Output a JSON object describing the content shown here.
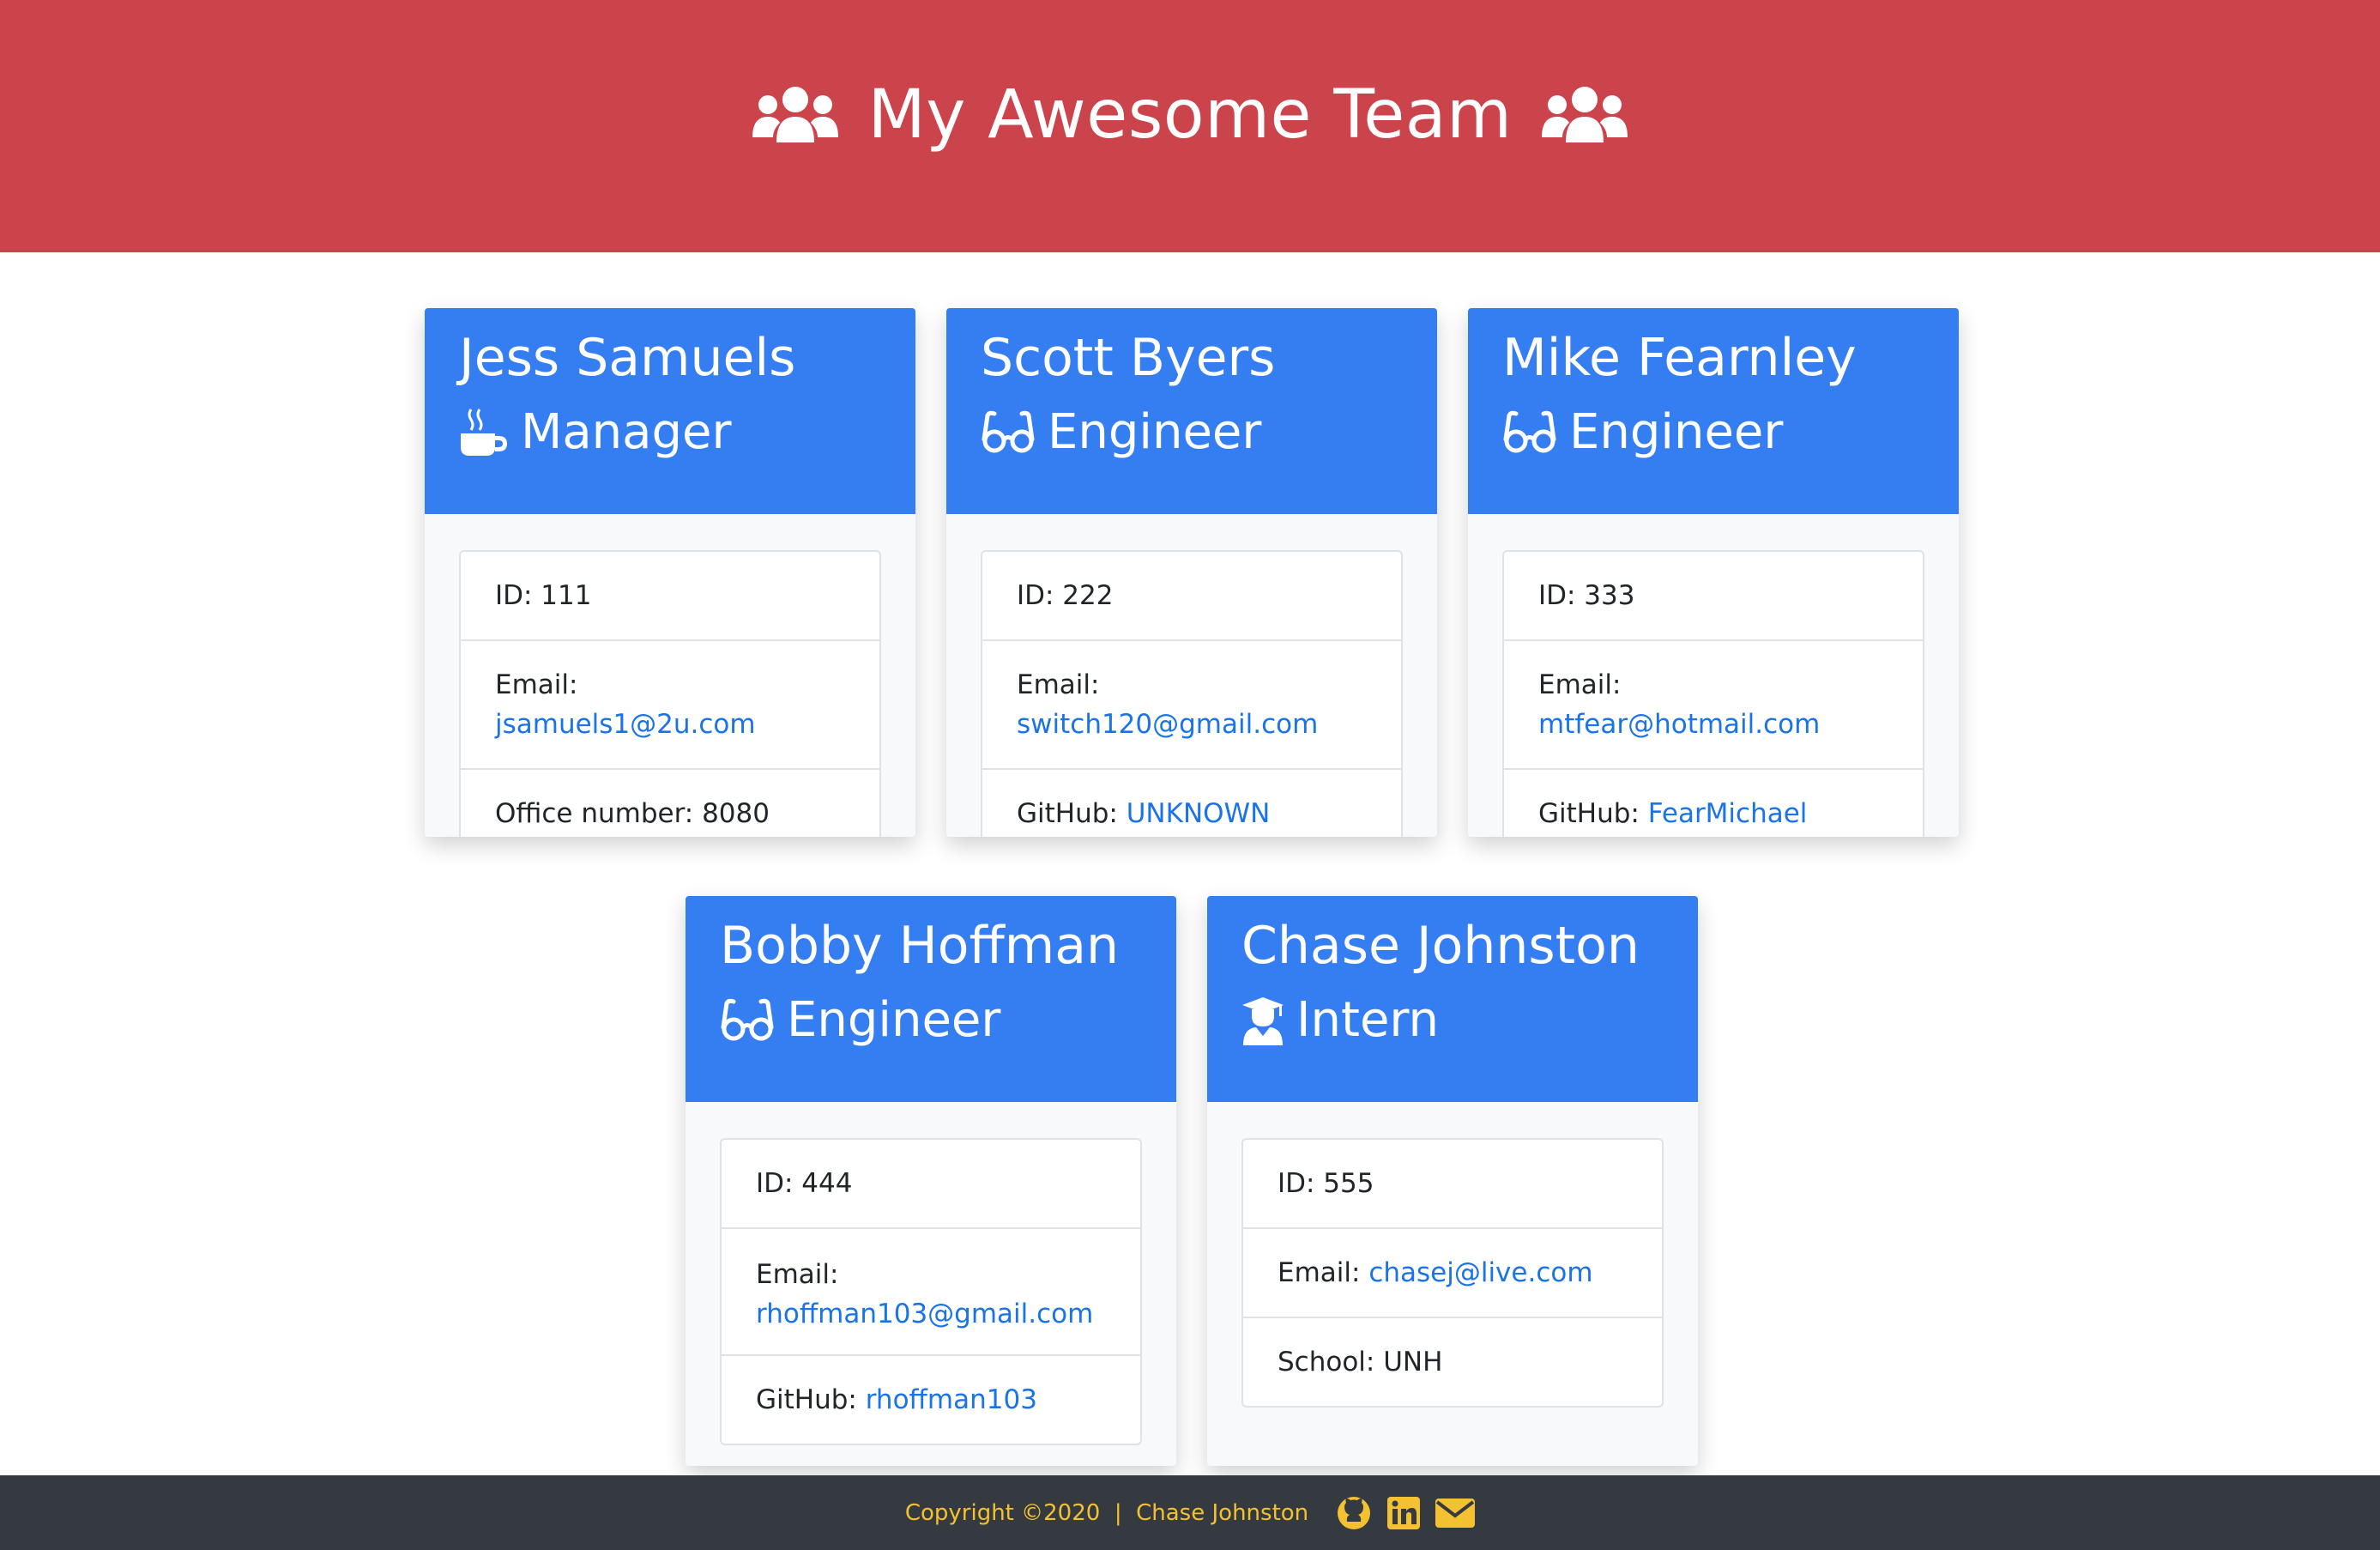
{
  "header": {
    "title": "My Awesome Team",
    "icon": "users-icon",
    "background": "#cc444b"
  },
  "accent": "#347ef2",
  "link_color": "#1a73e8",
  "cards": [
    {
      "name": "Jess Samuels",
      "role": "Manager",
      "role_icon": "coffee-mug-icon",
      "id_label": "ID: 111",
      "email_label": "Email:",
      "email": "jsamuels1@2u.com",
      "extra_label": "Office number: 8080",
      "extra_value": ""
    },
    {
      "name": "Scott Byers",
      "role": "Engineer",
      "role_icon": "glasses-icon",
      "id_label": "ID: 222",
      "email_label": "Email:",
      "email": "switch120@gmail.com",
      "extra_label": "GitHub:",
      "extra_value": "UNKNOWN"
    },
    {
      "name": "Mike Fearnley",
      "role": "Engineer",
      "role_icon": "glasses-icon",
      "id_label": "ID: 333",
      "email_label": "Email:",
      "email": "mtfear@hotmail.com",
      "extra_label": "GitHub:",
      "extra_value": "FearMichael"
    },
    {
      "name": "Bobby Hoffman",
      "role": "Engineer",
      "role_icon": "glasses-icon",
      "id_label": "ID: 444",
      "email_label": "Email:",
      "email": "rhoffman103@gmail.com",
      "extra_label": "GitHub:",
      "extra_value": "rhoffman103"
    },
    {
      "name": "Chase Johnston",
      "role": "Intern",
      "role_icon": "graduate-icon",
      "id_label": "ID: 555",
      "email_label": "Email:",
      "email": "chasej@live.com",
      "extra_label": "School: UNH",
      "extra_value": ""
    }
  ],
  "footer": {
    "copyright": "Copyright ©2020  |  Chase Johnston",
    "icons": [
      "github-icon",
      "linkedin-icon",
      "envelope-icon"
    ],
    "text_color": "#f4c132",
    "background": "#343a40"
  }
}
